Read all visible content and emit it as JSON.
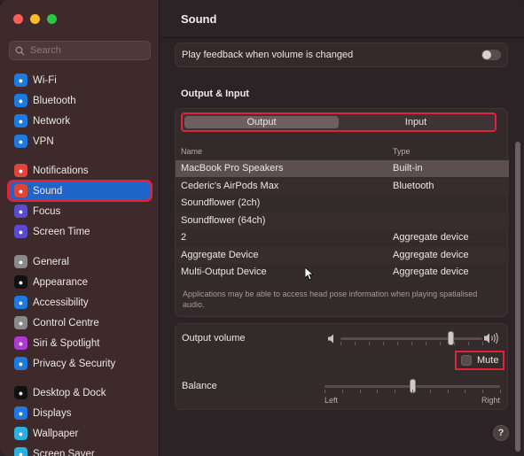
{
  "window": {
    "title": "Sound"
  },
  "search": {
    "placeholder": "Search"
  },
  "sidebar": {
    "items": [
      {
        "label": "Wi-Fi",
        "icon": "wifi-icon",
        "color": "#1f7ae0"
      },
      {
        "label": "Bluetooth",
        "icon": "bluetooth-icon",
        "color": "#1f7ae0"
      },
      {
        "label": "Network",
        "icon": "network-icon",
        "color": "#1f7ae0"
      },
      {
        "label": "VPN",
        "icon": "vpn-icon",
        "color": "#1f7ae0"
      },
      {
        "label": "Notifications",
        "icon": "notifications-icon",
        "color": "#e0453a"
      },
      {
        "label": "Sound",
        "icon": "sound-icon",
        "color": "#e0453a",
        "selected": true
      },
      {
        "label": "Focus",
        "icon": "focus-icon",
        "color": "#5b4bd0"
      },
      {
        "label": "Screen Time",
        "icon": "screen-time-icon",
        "color": "#5b4bd0"
      },
      {
        "label": "General",
        "icon": "general-icon",
        "color": "#8a8a8a"
      },
      {
        "label": "Appearance",
        "icon": "appearance-icon",
        "color": "#111111"
      },
      {
        "label": "Accessibility",
        "icon": "accessibility-icon",
        "color": "#1f7ae0"
      },
      {
        "label": "Control Centre",
        "icon": "control-centre-icon",
        "color": "#8a8a8a"
      },
      {
        "label": "Siri & Spotlight",
        "icon": "siri-icon",
        "color": "#b03ad0"
      },
      {
        "label": "Privacy & Security",
        "icon": "privacy-icon",
        "color": "#1f7ae0"
      },
      {
        "label": "Desktop & Dock",
        "icon": "desktop-dock-icon",
        "color": "#111111"
      },
      {
        "label": "Displays",
        "icon": "displays-icon",
        "color": "#1f7ae0"
      },
      {
        "label": "Wallpaper",
        "icon": "wallpaper-icon",
        "color": "#2bb0e0"
      },
      {
        "label": "Screen Saver",
        "icon": "screen-saver-icon",
        "color": "#2bb0e0"
      }
    ]
  },
  "feedback": {
    "label": "Play feedback when volume is changed"
  },
  "section": {
    "heading": "Output & Input"
  },
  "tabs": {
    "output": "Output",
    "input": "Input"
  },
  "table": {
    "col_name": "Name",
    "col_type": "Type",
    "rows": [
      {
        "name": "MacBook Pro Speakers",
        "type": "Built-in"
      },
      {
        "name": "Cederic's AirPods Max",
        "type": "Bluetooth"
      },
      {
        "name": "Soundflower (2ch)",
        "type": ""
      },
      {
        "name": "Soundflower (64ch)",
        "type": ""
      },
      {
        "name": "2",
        "type": "Aggregate device"
      },
      {
        "name": "Aggregate Device",
        "type": "Aggregate device"
      },
      {
        "name": "Multi-Output Device",
        "type": "Aggregate device"
      }
    ],
    "note": "Applications may be able to access head pose information when playing spatialised audio."
  },
  "output_volume": {
    "label": "Output volume",
    "level": 0.78
  },
  "mute": {
    "label": "Mute"
  },
  "balance": {
    "label": "Balance",
    "left": "Left",
    "right": "Right",
    "level": 0.5
  },
  "help": {
    "label": "?"
  }
}
